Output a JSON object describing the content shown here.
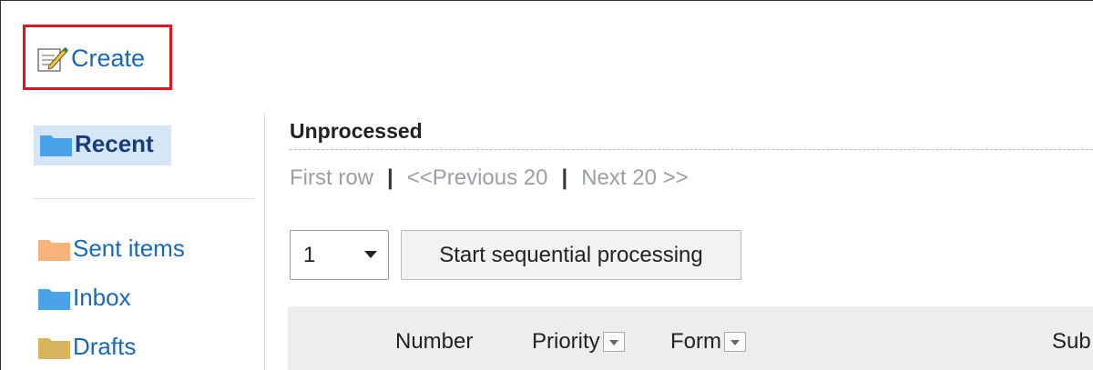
{
  "toolbar": {
    "create_label": "Create"
  },
  "sidebar": {
    "items": [
      {
        "label": "Recent",
        "selected": true,
        "folder_color": "#4aa3e8"
      },
      {
        "label": "Sent items",
        "folder_color": "#f7b37a"
      },
      {
        "label": "Inbox",
        "folder_color": "#4aa3e8"
      },
      {
        "label": "Drafts",
        "folder_color": "#d8b45a"
      }
    ]
  },
  "main": {
    "title": "Unprocessed",
    "pager": {
      "first": "First row",
      "prev": "<<Previous 20",
      "next": "Next 20 >>",
      "separator": "|"
    },
    "select": {
      "value": "1"
    },
    "sequential_button": "Start sequential processing",
    "columns": [
      "Number",
      "Priority",
      "Form",
      "Sub"
    ]
  },
  "colors": {
    "highlight_box": "#e0161e",
    "link": "#1a68b8",
    "selected_bg": "#d5e6f7"
  }
}
